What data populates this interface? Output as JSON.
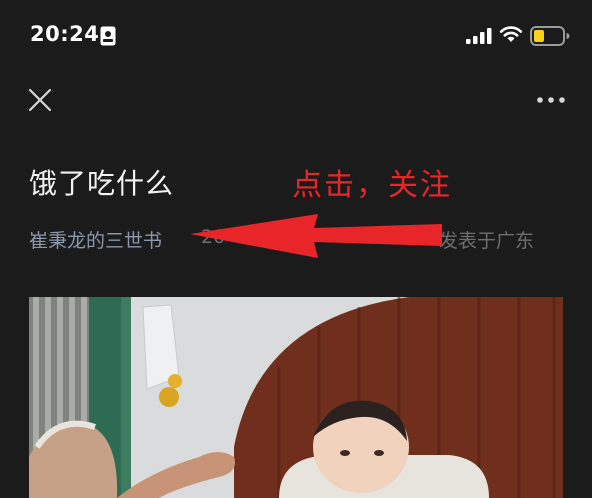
{
  "status_bar": {
    "time": "20:24",
    "icons": [
      "id-card-icon",
      "cellular-signal-icon",
      "wifi-icon",
      "battery-low-icon"
    ],
    "battery_color": "#f7d11a"
  },
  "nav": {
    "close_icon": "close-icon",
    "more_icon": "more-dots-icon"
  },
  "article": {
    "title": "饿了吃什么",
    "author": "崔秉龙的三世书",
    "date_partial": "20",
    "location": "发表于广东"
  },
  "annotation": {
    "text": "点击，关注",
    "color": "#e8262a"
  },
  "colors": {
    "background": "#1b1b1b",
    "author_link": "#8a97ac",
    "meta_text": "#6e6e6e"
  }
}
